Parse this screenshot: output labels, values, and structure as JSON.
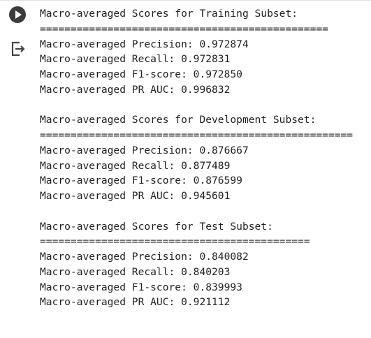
{
  "icons": {
    "run": "play-circle-icon",
    "output": "output-exit-icon"
  },
  "sections": [
    {
      "title": "Macro-averaged Scores for Training Subset:",
      "rule": "===============================================",
      "lines": [
        "Macro-averaged Precision: 0.972874",
        "Macro-averaged Recall: 0.972831",
        "Macro-averaged F1-score: 0.972850",
        "Macro-averaged PR AUC: 0.996832"
      ]
    },
    {
      "title": "Macro-averaged Scores for Development Subset:",
      "rule": "===================================================",
      "lines": [
        "Macro-averaged Precision: 0.876667",
        "Macro-averaged Recall: 0.877489",
        "Macro-averaged F1-score: 0.876599",
        "Macro-averaged PR AUC: 0.945601"
      ]
    },
    {
      "title": "Macro-averaged Scores for Test Subset:",
      "rule": "============================================",
      "lines": [
        "Macro-averaged Precision: 0.840082",
        "Macro-averaged Recall: 0.840203",
        "Macro-averaged F1-score: 0.839993",
        "Macro-averaged PR AUC: 0.921112"
      ]
    }
  ]
}
